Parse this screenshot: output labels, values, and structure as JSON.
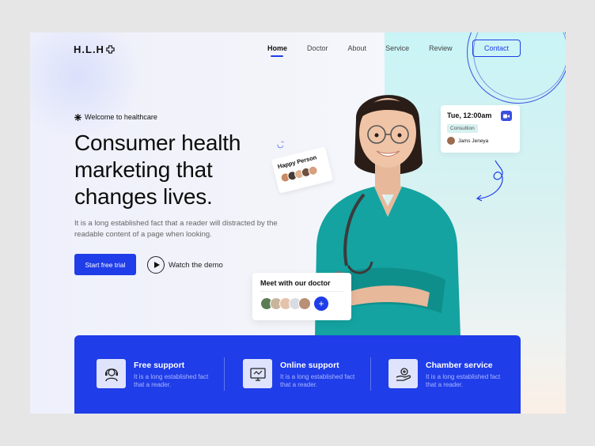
{
  "brand": {
    "logo_text": "H.L.H"
  },
  "nav": {
    "items": [
      {
        "label": "Home"
      },
      {
        "label": "Doctor"
      },
      {
        "label": "About"
      },
      {
        "label": "Service"
      },
      {
        "label": "Review"
      }
    ],
    "contact_label": "Contact"
  },
  "hero": {
    "welcome": "Welcome to healthcare",
    "headline": [
      "Consumer health",
      "marketing that",
      "changes lives."
    ],
    "description": "It is a long established fact that a reader will distracted by the readable content of a page when looking.",
    "primary_cta": "Start free trial",
    "secondary_cta": "Watch the demo"
  },
  "cards": {
    "happy_title": "Happy Person",
    "appointment": {
      "time": "Tue, 12:00am",
      "tag": "Consultion",
      "name": "Jams Jeneya"
    },
    "meet_title": "Meet  with our doctor",
    "meet_add": "+"
  },
  "features": [
    {
      "title": "Free support",
      "desc": "It is a long established fact that a reader.",
      "icon": "headset-icon"
    },
    {
      "title": "Online support",
      "desc": "It is a long established fact that a reader.",
      "icon": "monitor-icon"
    },
    {
      "title": "Chamber service",
      "desc": "It is a long established fact that a reader.",
      "icon": "care-hand-icon"
    }
  ],
  "colors": {
    "accent": "#1f3de8",
    "scrub": "#14a3a1",
    "text": "#0d0d0d"
  }
}
